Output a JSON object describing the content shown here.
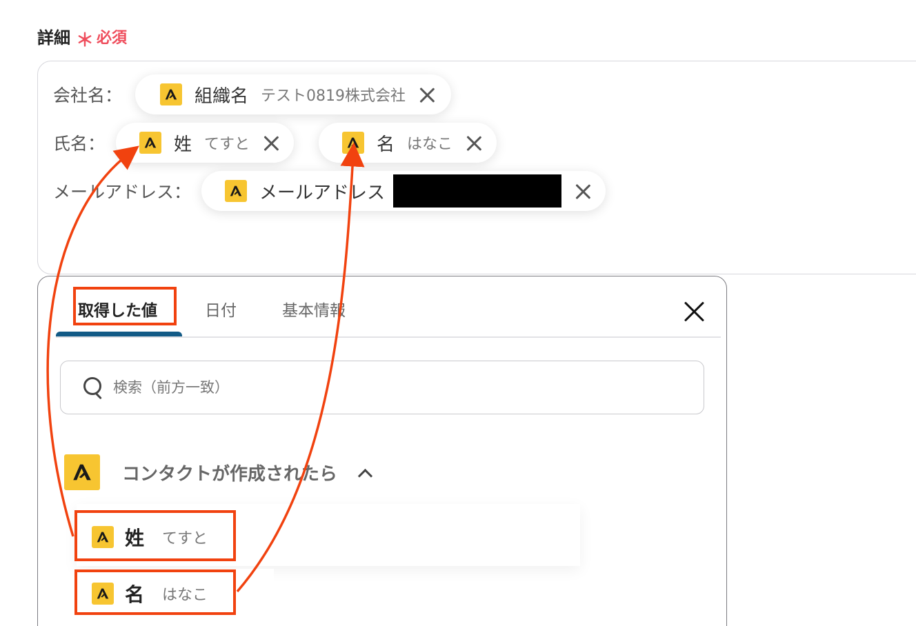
{
  "field": {
    "label": "詳細",
    "required_star": "＊",
    "required_text": "必須"
  },
  "details": {
    "rows": [
      {
        "label": "会社名：",
        "chips": [
          {
            "name": "組織名",
            "value": "テスト0819株式会社"
          }
        ]
      },
      {
        "label": "氏名：",
        "chips": [
          {
            "name": "姓",
            "value": "てすと"
          },
          {
            "name": "名",
            "value": "はなこ"
          }
        ]
      },
      {
        "label": "メールアドレス：",
        "chips": [
          {
            "name": "メールアドレス",
            "value": ""
          }
        ]
      }
    ]
  },
  "panel": {
    "tabs": [
      {
        "label": "取得した値",
        "active": true
      },
      {
        "label": "日付",
        "active": false
      },
      {
        "label": "基本情報",
        "active": false
      }
    ],
    "search_placeholder": "検索（前方一致）",
    "group": {
      "title": "コンタクトが作成されたら",
      "expanded": true,
      "items": [
        {
          "name": "姓",
          "value": "てすと"
        },
        {
          "name": "名",
          "value": "はなこ"
        }
      ]
    }
  },
  "icons": {
    "app": "yoom-app-icon",
    "close": "close-icon",
    "search": "search-icon",
    "chevron": "chevron-up-icon"
  },
  "colors": {
    "required": "#ef4d5c",
    "app_icon_bg": "#f7c531",
    "active_tab_underline": "#125a86",
    "annotation": "#f1420f"
  }
}
